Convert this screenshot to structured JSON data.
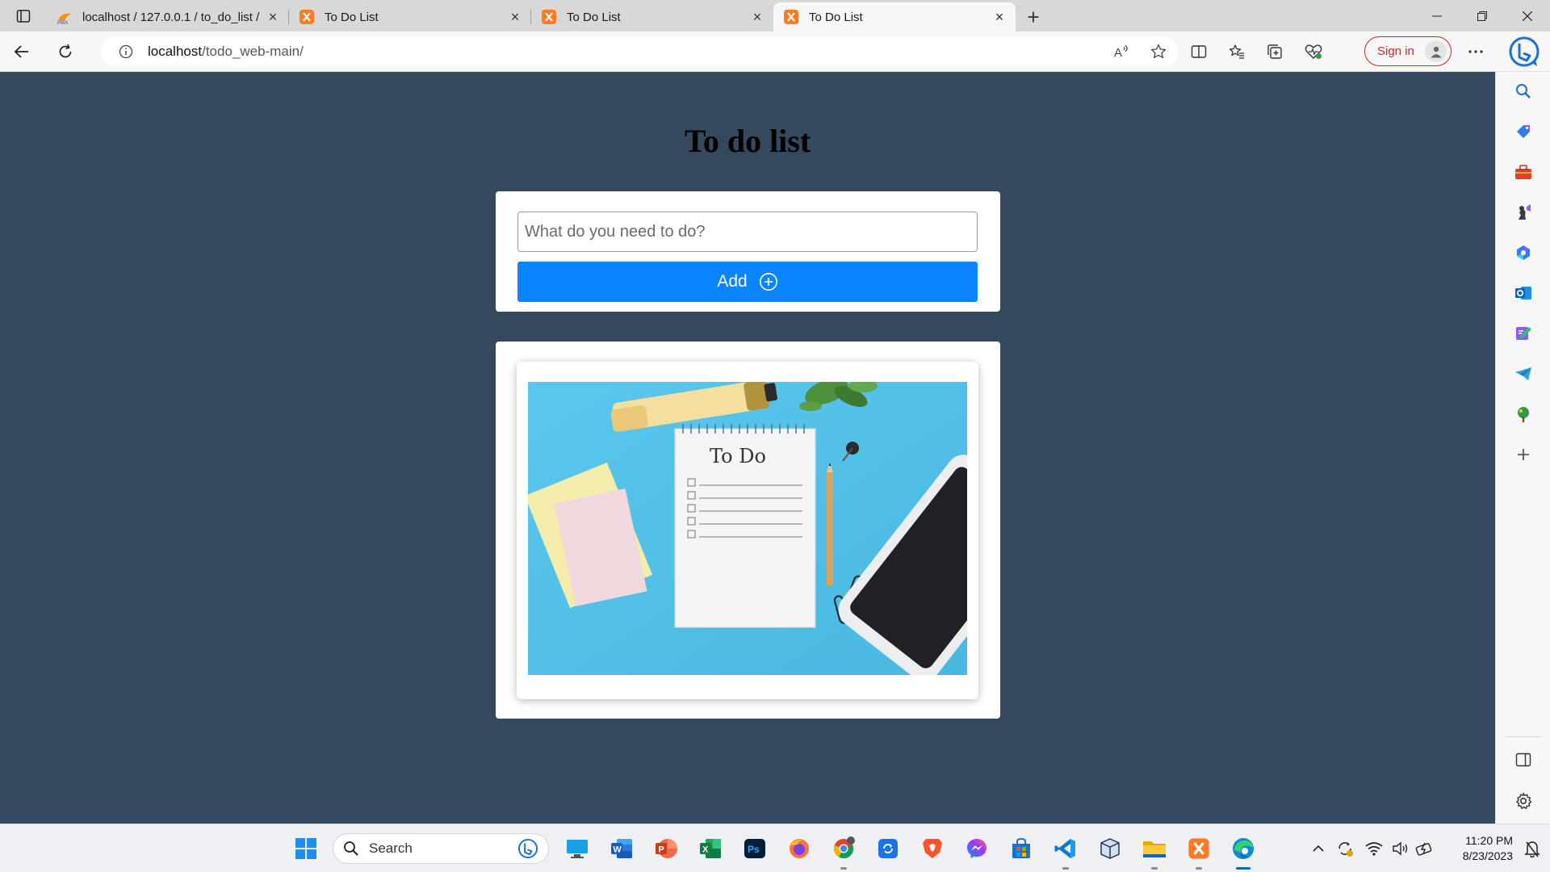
{
  "browser": {
    "tabs": [
      {
        "title": "localhost / 127.0.0.1 / to_do_list /",
        "favicon": "phpmyadmin-icon",
        "active": false
      },
      {
        "title": "To Do List",
        "favicon": "xampp-icon",
        "active": false
      },
      {
        "title": "To Do List",
        "favicon": "xampp-icon",
        "active": false
      },
      {
        "title": "To Do List",
        "favicon": "xampp-icon",
        "active": true
      }
    ],
    "new_tab": "+",
    "url_host": "localhost",
    "url_path": "/todo_web-main/",
    "sign_in_label": "Sign in"
  },
  "page": {
    "title": "To do list",
    "input_placeholder": "What do you need to do?",
    "input_value": "",
    "add_label": "Add",
    "image_caption": "To Do"
  },
  "sidebar": {
    "items": [
      "search-icon",
      "shopping-tag-icon",
      "tools-icon",
      "games-icon",
      "copilot-icon",
      "outlook-icon",
      "designer-icon",
      "telegram-icon",
      "tree-icon",
      "add-icon"
    ],
    "bottom": [
      "sidebar-toggle-icon",
      "settings-icon"
    ]
  },
  "taskbar": {
    "search_label": "Search",
    "apps": [
      "start-icon",
      "bing-icon",
      "remote-desktop-icon",
      "word-icon",
      "powerpoint-icon",
      "excel-icon",
      "photoshop-icon",
      "firefox-icon",
      "chrome-icon",
      "sync-icon",
      "brave-icon",
      "messenger-icon",
      "store-icon",
      "vscode-icon",
      "virtualbox-icon",
      "file-explorer-icon",
      "xampp-icon",
      "edge-icon"
    ],
    "time": "11:20 PM",
    "date": "8/23/2023"
  },
  "colors": {
    "page_background": "#34495e",
    "add_button": "#0a84ff",
    "card": "#ffffff"
  }
}
